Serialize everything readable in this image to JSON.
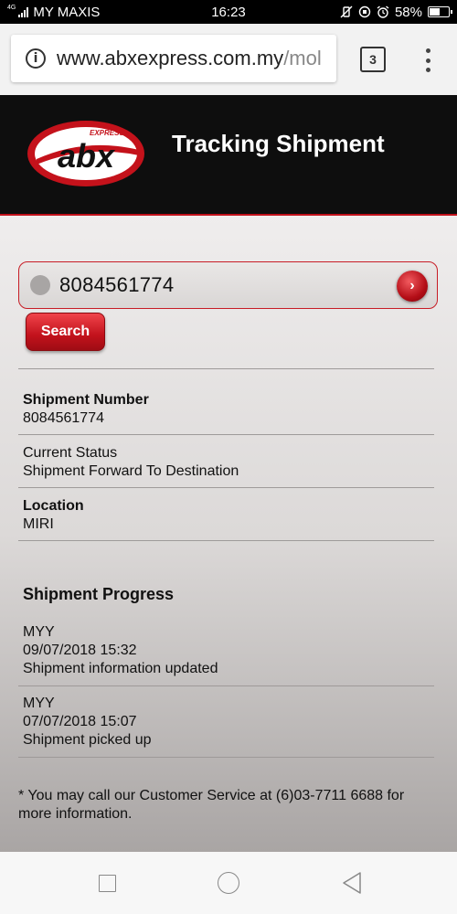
{
  "status_bar": {
    "network": "4G",
    "carrier": "MY MAXIS",
    "time": "16:23",
    "battery": "58%",
    "battery_level": 0.58
  },
  "browser": {
    "url_main": "www.abxexpress.com.my",
    "url_rest": "/mol",
    "tab_count": "3"
  },
  "header": {
    "logo_express": "EXPRESS",
    "logo_text": "abx",
    "title": "Tracking Shipment"
  },
  "search": {
    "input_value": "8084561774",
    "button_label": "Search"
  },
  "details": {
    "shipment_number_label": "Shipment Number",
    "shipment_number_value": "8084561774",
    "status_label": "Current Status",
    "status_value": "Shipment Forward To Destination",
    "location_label": "Location",
    "location_value": "MIRI"
  },
  "progress": {
    "title": "Shipment Progress",
    "events": [
      {
        "location": "MYY",
        "datetime": "09/07/2018 15:32",
        "description": "Shipment information updated"
      },
      {
        "location": "MYY",
        "datetime": "07/07/2018 15:07",
        "description": "Shipment picked up"
      }
    ]
  },
  "footer_note": "* You may call our Customer Service at (6)03-7711 6688 for more information.",
  "colors": {
    "brand_red": "#c0111b",
    "header_bg": "#0e0e0e"
  },
  "icons": {
    "info": "info-icon",
    "menu": "more-vert-icon",
    "go": "chevron-right-icon",
    "nav_recents": "square-icon",
    "nav_home": "circle-icon",
    "nav_back": "triangle-back-icon"
  }
}
